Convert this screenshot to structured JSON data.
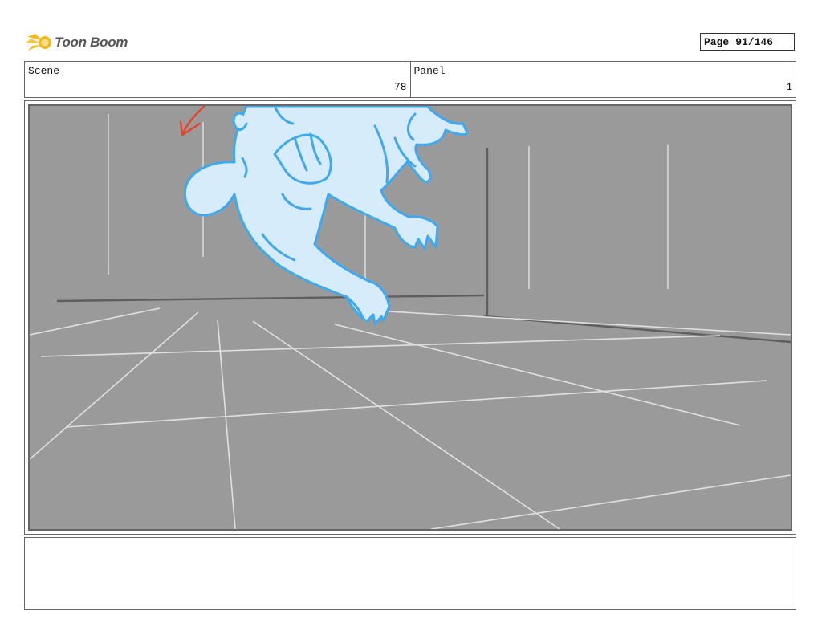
{
  "header": {
    "logo_text": "Toon Boom",
    "page_label": "Page",
    "page_value": "91/146"
  },
  "info": {
    "scene_label": "Scene",
    "scene_value": "78",
    "panel_label": "Panel",
    "panel_value": "1"
  },
  "colors": {
    "panel_background": "#9a9a9a",
    "character_fill": "#d6ecfb",
    "character_stroke": "#3fa9f0",
    "arrow": "#e0452a",
    "logo_yellow": "#f5b81e"
  },
  "notes": {
    "text": ""
  }
}
